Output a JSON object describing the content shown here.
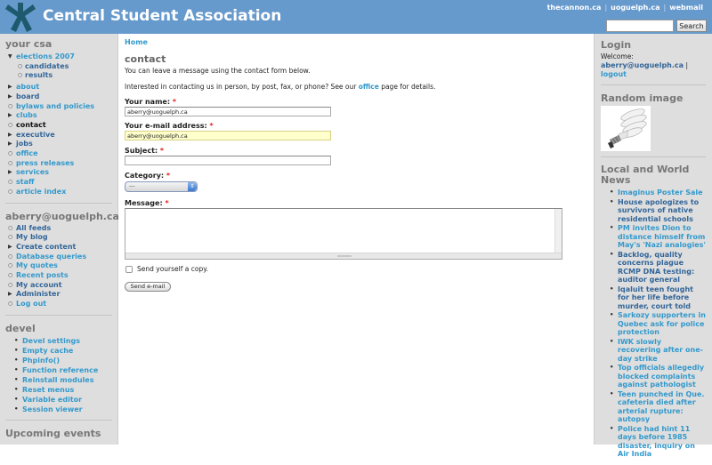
{
  "header": {
    "site_name": "Central Student Association",
    "top_links": [
      "thecannon.ca",
      "uoguelph.ca",
      "webmail"
    ],
    "search": {
      "value": "",
      "placeholder": "",
      "button_label": "Search"
    },
    "colors": {
      "header_bg": "#6699cc",
      "logo": "#1e5a6e"
    }
  },
  "left_sidebar": {
    "your_csa": {
      "title": "your csa",
      "items": [
        {
          "label": "elections 2007",
          "bullet": "expanded",
          "children": [
            {
              "label": "candidates"
            },
            {
              "label": "results"
            }
          ]
        },
        {
          "label": "about",
          "bullet": "collapsed"
        },
        {
          "label": "board",
          "bullet": "collapsed"
        },
        {
          "label": "bylaws and policies",
          "bullet": "leaf"
        },
        {
          "label": "clubs",
          "bullet": "collapsed"
        },
        {
          "label": "contact",
          "bullet": "leaf",
          "active": true
        },
        {
          "label": "executive",
          "bullet": "collapsed"
        },
        {
          "label": "jobs",
          "bullet": "collapsed"
        },
        {
          "label": "office",
          "bullet": "leaf"
        },
        {
          "label": "press releases",
          "bullet": "leaf"
        },
        {
          "label": "services",
          "bullet": "collapsed"
        },
        {
          "label": "staff",
          "bullet": "leaf"
        },
        {
          "label": "article index",
          "bullet": "leaf"
        }
      ]
    },
    "user_menu": {
      "title": "aberry@uoguelph.ca",
      "items": [
        {
          "label": "All feeds",
          "bullet": "leaf"
        },
        {
          "label": "My blog",
          "bullet": "leaf"
        },
        {
          "label": "Create content",
          "bullet": "collapsed"
        },
        {
          "label": "Database queries",
          "bullet": "leaf"
        },
        {
          "label": "My quotes",
          "bullet": "leaf"
        },
        {
          "label": "Recent posts",
          "bullet": "leaf"
        },
        {
          "label": "My account",
          "bullet": "leaf"
        },
        {
          "label": "Administer",
          "bullet": "collapsed"
        },
        {
          "label": "Log out",
          "bullet": "leaf"
        }
      ]
    },
    "devel": {
      "title": "devel",
      "items": [
        "Devel settings",
        "Empty cache",
        "Phpinfo()",
        "Function reference",
        "Reinstall modules",
        "Reset menus",
        "Variable editor",
        "Session viewer"
      ]
    },
    "upcoming": {
      "title": "Upcoming events"
    }
  },
  "main": {
    "breadcrumb": "Home",
    "title": "contact",
    "intro": "You can leave a message using the contact form below.",
    "details_prefix": "Interested in contacting us in person, by post, fax, or phone? See our ",
    "details_link": "office",
    "details_suffix": " page for details.",
    "form": {
      "required_marker": "*",
      "name": {
        "label": "Your name:",
        "value": "aberry@uoguelph.ca"
      },
      "email": {
        "label": "Your e-mail address:",
        "value": "aberry@uoguelph.ca"
      },
      "subject": {
        "label": "Subject:",
        "value": ""
      },
      "category": {
        "label": "Category:",
        "selected": "---"
      },
      "message": {
        "label": "Message:",
        "value": ""
      },
      "copy": {
        "label": "Send yourself a copy.",
        "checked": false
      },
      "submit_label": "Send e-mail"
    }
  },
  "right_sidebar": {
    "login": {
      "title": "Login",
      "welcome": "Welcome:",
      "user": "aberry@uoguelph.ca",
      "separator": "|",
      "logout": "logout"
    },
    "random_image": {
      "title": "Random image",
      "alt": "compact fluorescent light bulb"
    },
    "news": {
      "title": "Local and World News",
      "items": [
        "Imaginus Poster Sale",
        "House apologizes to survivors of native residential schools",
        "PM invites Dion to distance himself from May's 'Nazi analogies'",
        "Backlog, quality concerns plague RCMP DNA testing: auditor general",
        "Iqaluit teen fought for her life before murder, court told",
        "Sarkozy supporters in Quebec ask for police protection",
        "IWK slowly recovering after one-day strike",
        "Top officials allegedly blocked complaints against pathologist",
        "Teen punched in Que. cafeteria died after arterial rupture: autopsy",
        "Police had hint 11 days before 1985 disaster, inquiry on Air India"
      ]
    }
  }
}
